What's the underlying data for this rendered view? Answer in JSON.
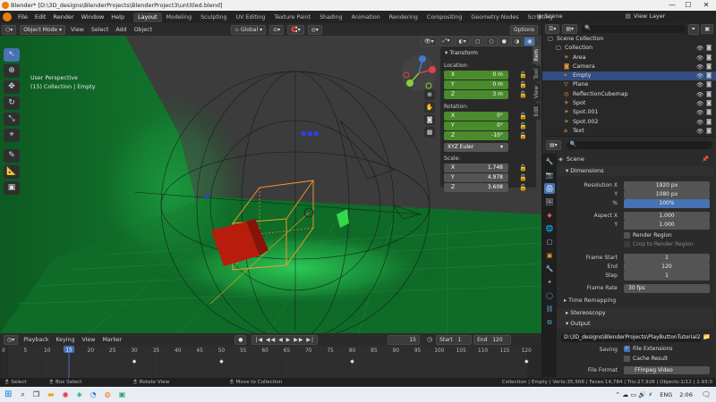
{
  "titlebar": {
    "title": "Blender* [D:\\3D_designs\\BlenderProjects\\BlenderProject3\\untitled.blend]",
    "minimize": "—",
    "maximize": "☐",
    "close": "✕"
  },
  "menubar": {
    "menus": [
      "File",
      "Edit",
      "Render",
      "Window",
      "Help"
    ],
    "workspaces": [
      "Layout",
      "Modeling",
      "Sculpting",
      "UV Editing",
      "Texture Paint",
      "Shading",
      "Animation",
      "Rendering",
      "Compositing",
      "Geometry Nodes",
      "Scripting"
    ],
    "active_workspace": "Layout",
    "scene_label": "Scene",
    "view_layer_label": "View Layer"
  },
  "viewport_header": {
    "mode": "Object Mode",
    "menus": [
      "View",
      "Select",
      "Add",
      "Object"
    ],
    "transform_orientation": "Global",
    "options": "Options"
  },
  "viewport": {
    "view_name": "User Perspective",
    "collection_info": "(15) Collection | Empty",
    "label_x": "x",
    "label_y": "y",
    "label_z": "z"
  },
  "npanel": {
    "tabs": [
      "Item",
      "Tool",
      "View",
      "Edit"
    ],
    "section": "Transform",
    "location_label": "Location:",
    "location": [
      {
        "axis": "X",
        "value": "0 m"
      },
      {
        "axis": "Y",
        "value": "0 m"
      },
      {
        "axis": "Z",
        "value": "3 m"
      }
    ],
    "rotation_label": "Rotation:",
    "rotation": [
      {
        "axis": "X",
        "value": "0°"
      },
      {
        "axis": "Y",
        "value": "0°"
      },
      {
        "axis": "Z",
        "value": "-10°"
      }
    ],
    "rotation_mode": "XYZ Euler",
    "scale_label": "Scale:",
    "scale": [
      {
        "axis": "X",
        "value": "1.748"
      },
      {
        "axis": "Y",
        "value": "4.978"
      },
      {
        "axis": "Z",
        "value": "3.608"
      }
    ]
  },
  "outliner": {
    "search_placeholder": "",
    "items": [
      {
        "name": "Scene Collection",
        "indent": 0,
        "selected": false,
        "icon": "collection-icon"
      },
      {
        "name": "Collection",
        "indent": 1,
        "selected": false,
        "icon": "collection-icon"
      },
      {
        "name": "Area",
        "indent": 2,
        "selected": false,
        "icon": "light-icon"
      },
      {
        "name": "Camera",
        "indent": 2,
        "selected": false,
        "icon": "camera-icon"
      },
      {
        "name": "Empty",
        "indent": 2,
        "selected": true,
        "icon": "empty-icon"
      },
      {
        "name": "Plane",
        "indent": 2,
        "selected": false,
        "icon": "mesh-icon"
      },
      {
        "name": "ReflectionCubemap",
        "indent": 2,
        "selected": false,
        "icon": "probe-icon"
      },
      {
        "name": "Spot",
        "indent": 2,
        "selected": false,
        "icon": "light-icon"
      },
      {
        "name": "Spot.001",
        "indent": 2,
        "selected": false,
        "icon": "light-icon"
      },
      {
        "name": "Spot.002",
        "indent": 2,
        "selected": false,
        "icon": "light-icon"
      },
      {
        "name": "Text",
        "indent": 2,
        "selected": false,
        "icon": "text-icon"
      }
    ]
  },
  "properties": {
    "scene_name": "Scene",
    "dimensions": "Dimensions",
    "resolution_x_label": "Resolution X",
    "resolution_x": "1920 px",
    "resolution_y_label": "Y",
    "resolution_y": "1080 px",
    "percent_label": "%",
    "percent": "100%",
    "aspect_x_label": "Aspect X",
    "aspect_x": "1.000",
    "aspect_y_label": "Y",
    "aspect_y": "1.000",
    "render_region": "Render Region",
    "crop_region": "Crop to Render Region",
    "frame_start_label": "Frame Start",
    "frame_start": "1",
    "frame_end_label": "End",
    "frame_end": "120",
    "frame_step_label": "Step",
    "frame_step": "1",
    "frame_rate_label": "Frame Rate",
    "frame_rate": "30 fps",
    "time_remapping": "Time Remapping",
    "stereoscopy": "Stereoscopy",
    "output": "Output",
    "output_path": "D:\\3D_designs\\BlenderProjects\\PlayButtonTutorial2",
    "saving_label": "Saving",
    "file_extensions": "File Extensions",
    "cache_result": "Cache Result",
    "file_format_label": "File Format",
    "file_format": "FFmpeg Video"
  },
  "timeline": {
    "menus": [
      "Playback",
      "Keying",
      "View",
      "Marker"
    ],
    "current_frame": "15",
    "start_label": "Start",
    "start": "1",
    "end_label": "End",
    "end": "120",
    "ticks": [
      "0",
      "5",
      "10",
      "15",
      "20",
      "25",
      "30",
      "35",
      "40",
      "45",
      "50",
      "55",
      "60",
      "65",
      "70",
      "75",
      "80",
      "85",
      "90",
      "95",
      "100",
      "105",
      "110",
      "115",
      "120"
    ],
    "keyframes": [
      30,
      50,
      80,
      120
    ]
  },
  "statusbar": {
    "select": "Select",
    "box_select": "Box Select",
    "rotate_view": "Rotate View",
    "move_collection": "Move to Collection",
    "stats": "Collection | Empty | Verts:35,566 | Faces:14,784 | Tris:27,928 | Objects:1/12 | 2.93.0"
  },
  "taskbar": {
    "language": "ENG",
    "time": "2:06"
  },
  "colors": {
    "accent": "#4772b3",
    "green_field": "#4a8b2b",
    "active_object": "#e8a030"
  }
}
